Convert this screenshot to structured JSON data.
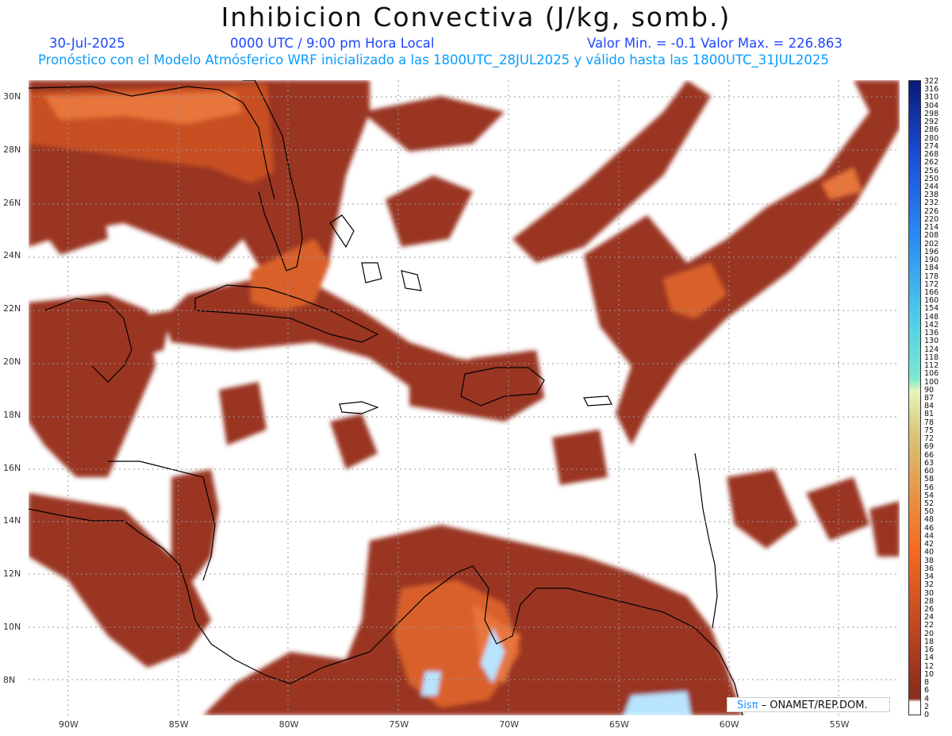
{
  "header": {
    "title": "Inhibicion Convectiva (J/kg, somb.)",
    "date": "30-Jul-2025",
    "time": "0000 UTC / 9:00 pm Hora Local",
    "minmax": "Valor Min. = -0.1  Valor Max. = 226.863",
    "forecast": "Pronóstico con el Modelo Atmósferico WRF inicializado a las 1800UTC_28JUL2025 y válido hasta las  1800UTC_31JUL2025"
  },
  "axes": {
    "lat_labels": [
      "30N",
      "28N",
      "26N",
      "24N",
      "22N",
      "20N",
      "18N",
      "16N",
      "14N",
      "12N",
      "10N",
      "8N"
    ],
    "lon_labels": [
      "90W",
      "85W",
      "80W",
      "75W",
      "70W",
      "65W",
      "60W",
      "55W"
    ]
  },
  "colorbar": {
    "labels": [
      "322",
      "316",
      "310",
      "304",
      "298",
      "292",
      "286",
      "280",
      "274",
      "268",
      "262",
      "256",
      "250",
      "244",
      "238",
      "232",
      "226",
      "220",
      "214",
      "208",
      "202",
      "196",
      "190",
      "184",
      "178",
      "172",
      "166",
      "160",
      "154",
      "148",
      "142",
      "136",
      "130",
      "124",
      "118",
      "112",
      "106",
      "100",
      "90",
      "87",
      "84",
      "81",
      "78",
      "75",
      "72",
      "69",
      "66",
      "63",
      "60",
      "58",
      "56",
      "54",
      "52",
      "50",
      "48",
      "46",
      "44",
      "42",
      "40",
      "38",
      "36",
      "34",
      "32",
      "30",
      "28",
      "26",
      "24",
      "22",
      "20",
      "18",
      "16",
      "14",
      "12",
      "10",
      "8",
      "6",
      "4",
      "2",
      "0"
    ]
  },
  "credit": {
    "sis": "Sisπ",
    "org": "– ONAMET/REP.DOM."
  },
  "colors": {
    "field_dark": "#8e2e1c",
    "field_mid": "#c64a20",
    "field_light": "#f07a3a",
    "field_high": "#bfe6ff",
    "coast": "#000000",
    "grid": "#999999"
  }
}
